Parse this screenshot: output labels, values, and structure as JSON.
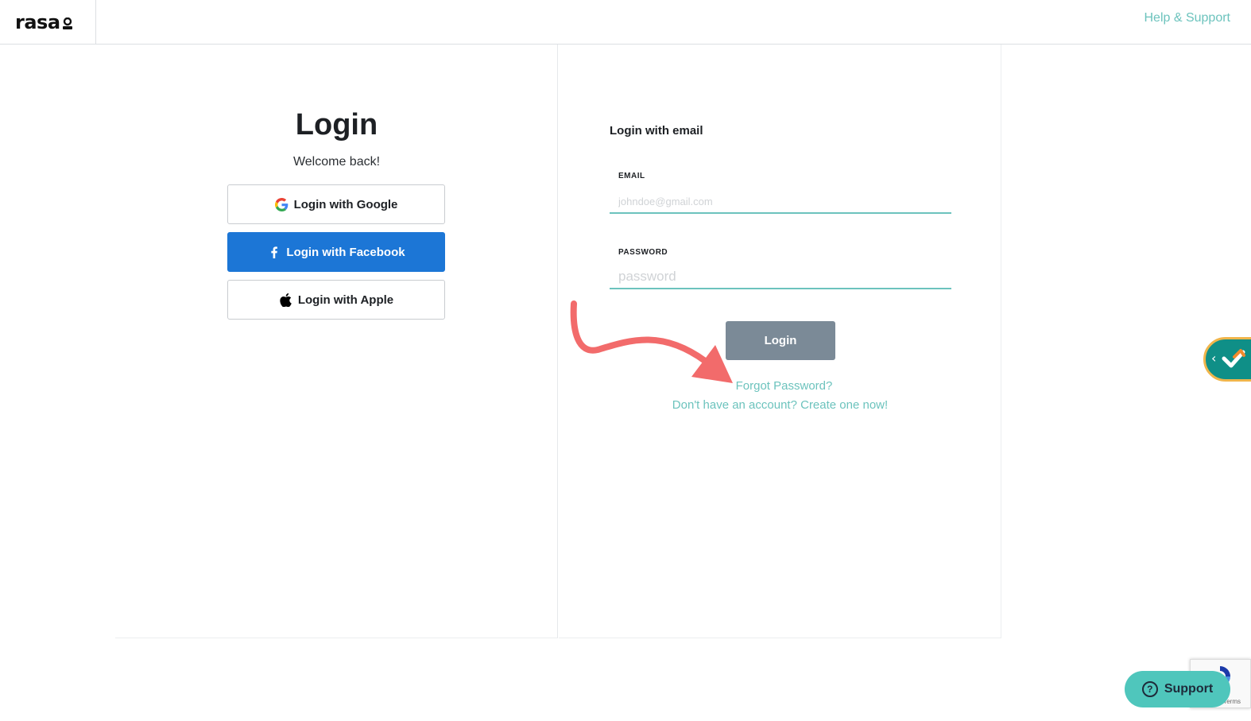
{
  "header": {
    "logo_text": "rasa",
    "help_link": "Help & Support"
  },
  "left_panel": {
    "title": "Login",
    "subtitle": "Welcome back!",
    "google_button": "Login with Google",
    "facebook_button": "Login with Facebook",
    "apple_button": "Login with Apple"
  },
  "right_panel": {
    "heading": "Login with email",
    "email_label": "EMAIL",
    "email_placeholder": "johndoe@gmail.com",
    "password_label": "PASSWORD",
    "password_placeholder": "password",
    "login_button": "Login",
    "forgot_password": "Forgot Password?",
    "create_account": "Don't have an account? Create one now!"
  },
  "widgets": {
    "recaptcha_terms": "Terms",
    "support_button": "Support",
    "support_icon": "?"
  },
  "colors": {
    "accent_teal": "#6cc3bd",
    "facebook_blue": "#1c76d6",
    "login_button_gray": "#7b8a97",
    "annotation_arrow": "#f26b6b",
    "support_teal": "#4fc6bc"
  }
}
